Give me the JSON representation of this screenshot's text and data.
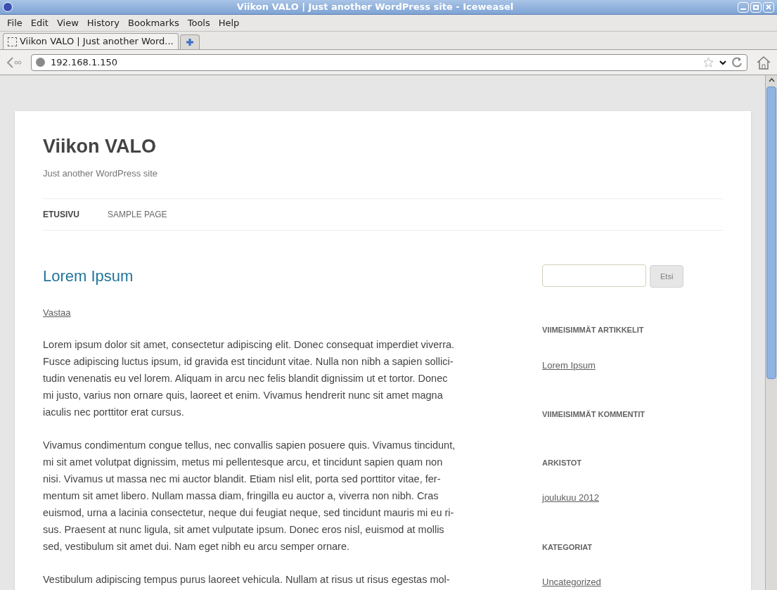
{
  "window": {
    "title": "Viikon VALO | Just another WordPress site - Iceweasel"
  },
  "menu": [
    {
      "label": "File"
    },
    {
      "label": "Edit"
    },
    {
      "label": "View"
    },
    {
      "label": "History"
    },
    {
      "label": "Bookmarks"
    },
    {
      "label": "Tools"
    },
    {
      "label": "Help"
    }
  ],
  "tabs": [
    {
      "label": "Viikon VALO | Just another Word...",
      "selected": true
    }
  ],
  "address_bar": {
    "value": "192.168.1.150"
  },
  "site": {
    "title": "Viikon VALO",
    "tagline": "Just another WordPress site",
    "nav": [
      {
        "label": "ETUSIVU",
        "selected": true
      },
      {
        "label": "SAMPLE PAGE",
        "selected": false
      }
    ]
  },
  "post": {
    "title": "Lorem Ipsum",
    "reply_link": "Vastaa",
    "paragraphs": [
      [
        "Lorem ipsum dolor sit amet, consectetur adipiscing elit. Donec consequat imperdiet viverra.",
        "Fusce adipiscing luctus ipsum, id gravida est tincidunt vitae. Nulla non nibh a sapien sollici-",
        "tudin venenatis eu vel lorem. Aliquam in arcu nec felis blandit dignissim ut et tortor. Donec",
        "mi justo, varius non ornare quis, laoreet et enim. Vivamus hendrerit nunc sit amet magna",
        "iaculis nec porttitor erat cursus."
      ],
      [
        "Vivamus condimentum congue tellus, nec convallis sapien posuere quis. Vivamus tincidunt,",
        "mi sit amet volutpat dignissim, metus mi pellentesque arcu, et tincidunt sapien quam non",
        "nisi. Vivamus ut massa nec mi auctor blandit. Etiam nisl elit, porta sed porttitor vitae, fer-",
        "mentum sit amet libero. Nullam massa diam, fringilla eu auctor a, viverra non nibh. Cras",
        "euismod, urna a lacinia consectetur, neque dui feugiat neque, sed tincidunt mauris mi eu ri-",
        "sus. Praesent at nunc ligula, sit amet vulputate ipsum. Donec eros nisl, euismod at mollis",
        "sed, vestibulum sit amet dui. Nam eget nibh eu arcu semper ornare."
      ],
      [
        "Vestibulum adipiscing tempus purus laoreet vehicula. Nullam at risus ut risus egestas mol-"
      ]
    ]
  },
  "sidebar": {
    "search_button": "Etsi",
    "widgets": [
      {
        "heading": "VIIMEISIMMÄT ARTIKKELIT",
        "links": [
          "Lorem Ipsum"
        ]
      },
      {
        "heading": "VIIMEISIMMÄT KOMMENTIT"
      },
      {
        "heading": "ARKISTOT",
        "links": [
          "joulukuu 2012"
        ]
      },
      {
        "heading": "KATEGORIAT",
        "links": [
          "Uncategorized"
        ]
      }
    ]
  }
}
